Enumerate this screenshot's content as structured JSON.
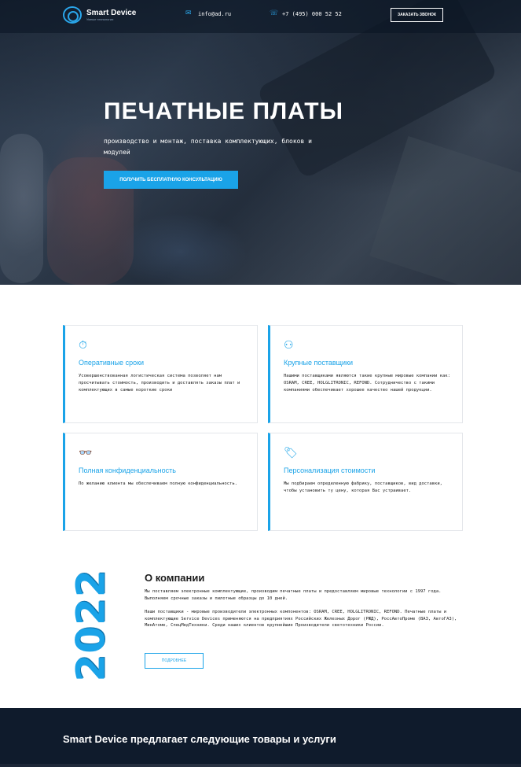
{
  "header": {
    "logo_title": "Smart Device",
    "logo_subtitle": "Умные технологии",
    "email": "info@ad.ru",
    "phone": "+7 (495) 000 52 52",
    "callback_label": "ЗАКАЗАТЬ ЗВОНОК"
  },
  "hero": {
    "title": "ПЕЧАТНЫЕ ПЛАТЫ",
    "text": "производство и монтаж, поставка комплектующих, блоков и модулей",
    "button_label": "ПОЛУЧИТЬ БЕСПЛАТНУЮ КОНСУЛЬТАЦИЮ"
  },
  "features": [
    {
      "icon": "stopwatch-icon",
      "title": "Оперативные сроки",
      "text": "Усовершенствованная логистическая система позволяет нам просчитывать стоимость, производить и доставлять заказы плат и комплектующих в самые короткие сроки"
    },
    {
      "icon": "suppliers-icon",
      "title": "Крупные поставщики",
      "text": "Нашими поставщиками являются такие крупные мировые компании как: OSRAM, CREE, HOLGLITRONIC, REFOND. Сотрудничество с такими компаниями обеспечивает хорошее качество нашей продукции."
    },
    {
      "icon": "incognito-icon",
      "title": "Полная конфиденциальность",
      "text": "По желанию клиента мы обеспечиваем полную конфиденциальность."
    },
    {
      "icon": "price-tag-icon",
      "title": "Персонализация стоимости",
      "text": "Мы подбираем определенную фабрику, поставщиков, вид доставки, чтобы установить ту цену, которая Вас устраивает."
    }
  ],
  "about": {
    "year": "2022",
    "title": "О компании",
    "paragraph1": "Мы поставляем электронные комплектующие, производим печатные платы и предоставляем мировые технологии с 1997 года. Выполняем срочные заказы и пилотные образцы до 10 дней.",
    "paragraph2": "Наши поставщики - мировые производители электронных компонентов: OSRAM, CREE, HOLGLITRONIC, REFOND. Печатные платы и комплектующие Service Devices применяются на предприятиях Российских Железных Дорог (РЖД), РосcАвтоПроме (ВАЗ, АвтоГАЗ), МинАтоме, СпецМедТехники. Среди наших клиентов крупнейшие Производители светотехники России.",
    "button_label": "ПОДРОБНЕЕ"
  },
  "bottom": {
    "title": "Smart Device предлагает следующие товары и услуги"
  },
  "colors": {
    "accent": "#1aa3e8",
    "dark": "#0f1b2c"
  }
}
